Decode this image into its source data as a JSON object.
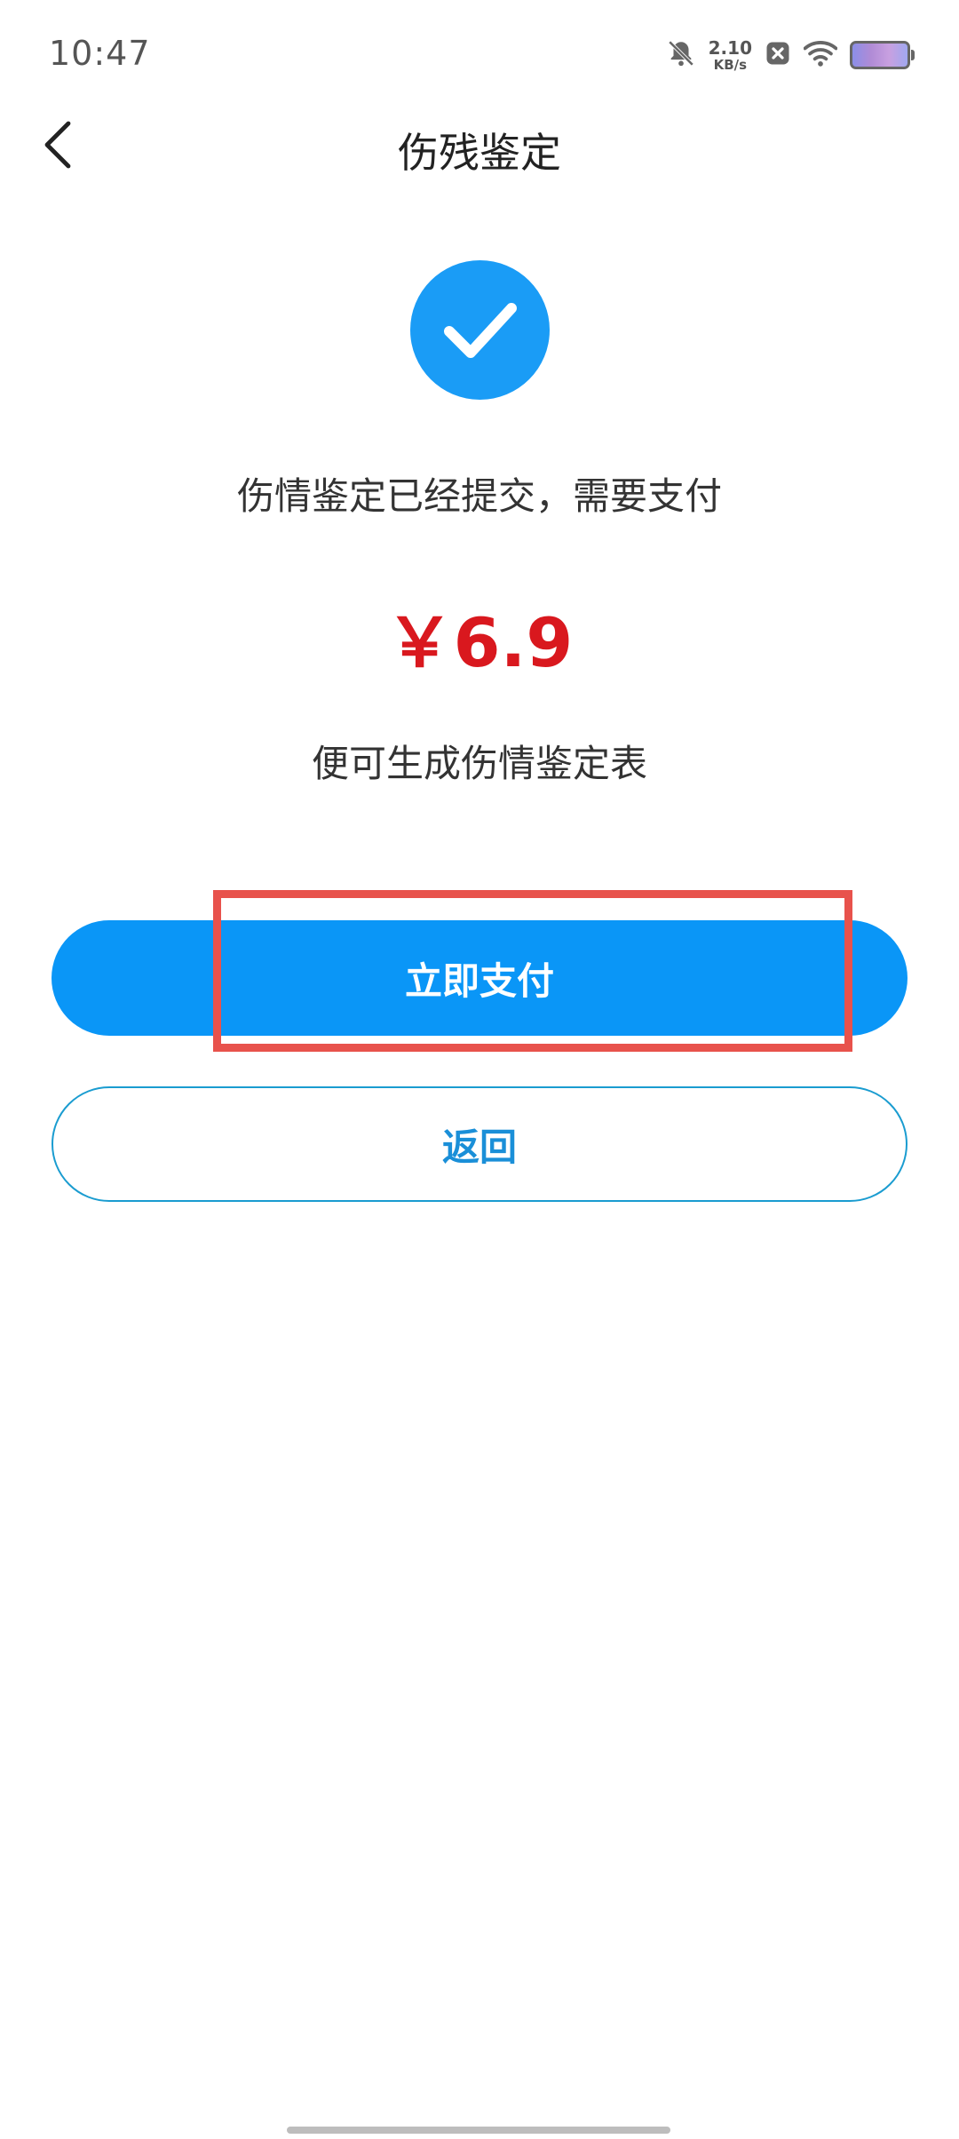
{
  "status_bar": {
    "time": "10:47",
    "net_speed_value": "2.10",
    "net_speed_unit": "KB/s",
    "icons": [
      "bell-muted-icon",
      "close-box-icon",
      "wifi-icon",
      "battery-icon"
    ]
  },
  "header": {
    "back_icon": "chevron-left-icon",
    "title": "伤残鉴定"
  },
  "main": {
    "success_icon": "check-circle-icon",
    "message_submitted": "伤情鉴定已经提交，需要支付",
    "price": "￥6.9",
    "message_generate": "便可生成伤情鉴定表",
    "pay_button_label": "立即支付",
    "back_button_label": "返回"
  },
  "colors": {
    "accent": "#0a96f7",
    "price": "#d9181e",
    "highlight": "#e8524c"
  }
}
